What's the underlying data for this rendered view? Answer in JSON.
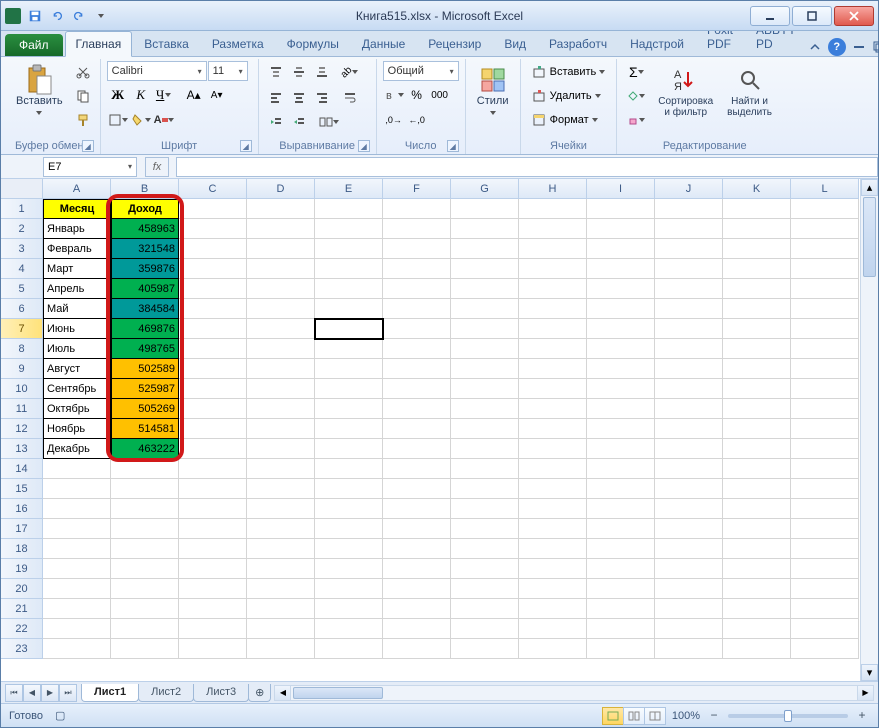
{
  "titlebar": {
    "title": "Книга515.xlsx - Microsoft Excel"
  },
  "tabs": {
    "file": "Файл",
    "items": [
      "Главная",
      "Вставка",
      "Разметка",
      "Формулы",
      "Данные",
      "Рецензир",
      "Вид",
      "Разработч",
      "Надстрой",
      "Foxit PDF",
      "ABBYY PD"
    ],
    "active": 0
  },
  "ribbon": {
    "clipboard": {
      "paste": "Вставить",
      "label": "Буфер обмена"
    },
    "font": {
      "name": "Calibri",
      "size": "11",
      "label": "Шрифт"
    },
    "align": {
      "label": "Выравнивание"
    },
    "number": {
      "format": "Общий",
      "label": "Число"
    },
    "styles": {
      "btn": "Стили",
      "label": ""
    },
    "cells": {
      "insert": "Вставить",
      "delete": "Удалить",
      "format": "Формат",
      "label": "Ячейки"
    },
    "editing": {
      "sort": "Сортировка\nи фильтр",
      "find": "Найти и\nвыделить",
      "label": "Редактирование"
    }
  },
  "formula_bar": {
    "namebox": "E7",
    "fx_label": "fx",
    "formula": ""
  },
  "grid": {
    "columns": [
      "A",
      "B",
      "C",
      "D",
      "E",
      "F",
      "G",
      "H",
      "I",
      "J",
      "K",
      "L"
    ],
    "row_count": 23,
    "headers": {
      "a": "Месяц",
      "b": "Доход"
    },
    "data": [
      {
        "month": "Январь",
        "value": "458963",
        "bg": "bg-gr"
      },
      {
        "month": "Февраль",
        "value": "321548",
        "bg": "bg-te"
      },
      {
        "month": "Март",
        "value": "359876",
        "bg": "bg-te"
      },
      {
        "month": "Апрель",
        "value": "405987",
        "bg": "bg-gr"
      },
      {
        "month": "Май",
        "value": "384584",
        "bg": "bg-te"
      },
      {
        "month": "Июнь",
        "value": "469876",
        "bg": "bg-gr"
      },
      {
        "month": "Июль",
        "value": "498765",
        "bg": "bg-gr"
      },
      {
        "month": "Август",
        "value": "502589",
        "bg": "bg-or"
      },
      {
        "month": "Сентябрь",
        "value": "525987",
        "bg": "bg-or"
      },
      {
        "month": "Октябрь",
        "value": "505269",
        "bg": "bg-or"
      },
      {
        "month": "Ноябрь",
        "value": "514581",
        "bg": "bg-or"
      },
      {
        "month": "Декабрь",
        "value": "463222",
        "bg": "bg-gr"
      }
    ],
    "active_cell": {
      "col": 4,
      "row": 7
    },
    "highlighted_row": 7
  },
  "sheet_tabs": {
    "items": [
      "Лист1",
      "Лист2",
      "Лист3"
    ],
    "active": 0
  },
  "status": {
    "ready": "Готово",
    "zoom": "100%"
  }
}
